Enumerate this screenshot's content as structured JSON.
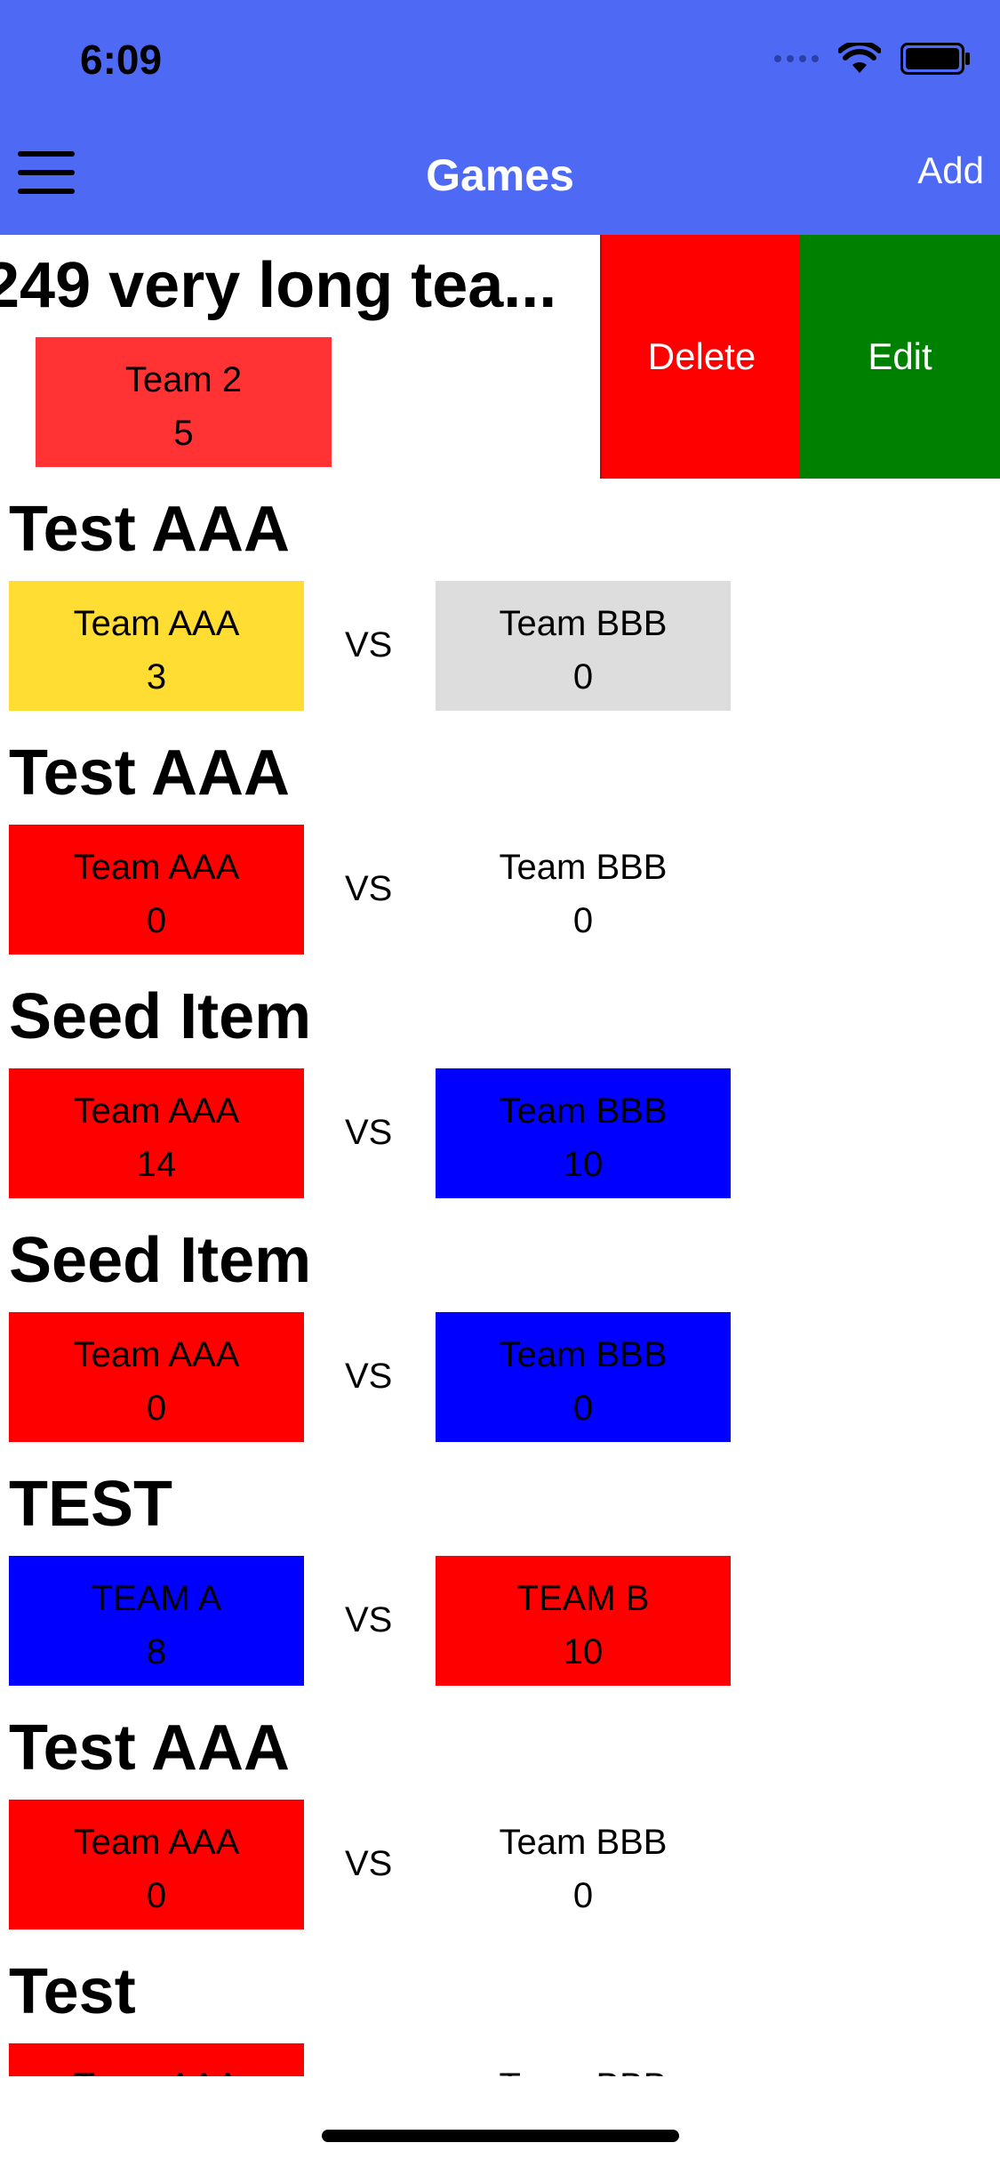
{
  "status": {
    "time": "6:09"
  },
  "nav": {
    "title": "Games",
    "add_label": "Add"
  },
  "actions": {
    "delete_label": "Delete",
    "edit_label": "Edit"
  },
  "vs_label": "VS",
  "games": [
    {
      "title": "249 very long tea...",
      "home": {
        "name": "Team 2",
        "score": "5",
        "color": "#FF3333"
      }
    },
    {
      "title": "Test AAA",
      "home": {
        "name": "Team AAA",
        "score": "3",
        "color": "#FFDD33"
      },
      "away": {
        "name": "Team BBB",
        "score": "0",
        "color": "#DDDDDD"
      }
    },
    {
      "title": "Test AAA",
      "home": {
        "name": "Team AAA",
        "score": "0",
        "color": "#FF0000"
      },
      "away": {
        "name": "Team BBB",
        "score": "0",
        "color": "#FFFFFF"
      }
    },
    {
      "title": "Seed Item",
      "home": {
        "name": "Team AAA",
        "score": "14",
        "color": "#FF0000"
      },
      "away": {
        "name": "Team BBB",
        "score": "10",
        "color": "#0000FF"
      }
    },
    {
      "title": "Seed Item",
      "home": {
        "name": "Team AAA",
        "score": "0",
        "color": "#FF0000"
      },
      "away": {
        "name": "Team BBB",
        "score": "0",
        "color": "#0000FF"
      }
    },
    {
      "title": "TEST",
      "home": {
        "name": "TEAM A",
        "score": "8",
        "color": "#0000FF"
      },
      "away": {
        "name": "TEAM B",
        "score": "10",
        "color": "#FF0000"
      }
    },
    {
      "title": "Test AAA",
      "home": {
        "name": "Team AAA",
        "score": "0",
        "color": "#FF0000"
      },
      "away": {
        "name": "Team BBB",
        "score": "0",
        "color": "#FFFFFF"
      }
    },
    {
      "title": "Test",
      "home": {
        "name": "Team AAA",
        "score": "",
        "color": "#FF0000"
      },
      "away": {
        "name": "Team BBB",
        "score": "",
        "color": "#FFFFFF"
      }
    }
  ]
}
